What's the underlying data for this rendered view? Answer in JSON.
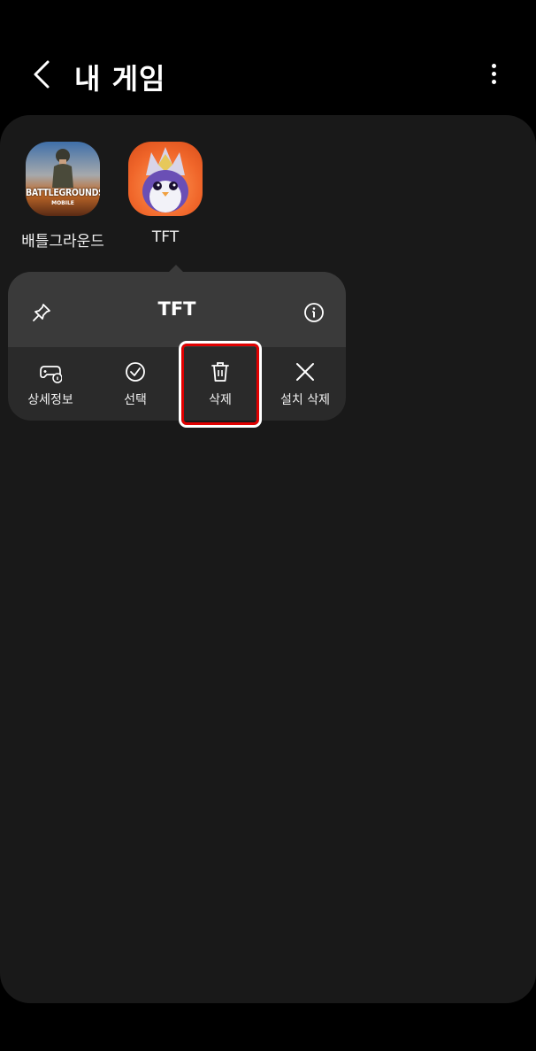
{
  "header": {
    "title": "내 게임",
    "back_icon": "chevron-left-icon",
    "more_icon": "more-vertical-icon"
  },
  "games": [
    {
      "name": "배틀그라운드",
      "icon": "pubg-game-icon",
      "icon_text": "BATTLEGROUNDS",
      "icon_subtext": "MOBILE"
    },
    {
      "name": "TFT",
      "icon": "tft-game-icon"
    }
  ],
  "popup": {
    "title": "TFT",
    "pin_icon": "pin-icon",
    "info_icon": "info-icon",
    "actions": [
      {
        "label": "상세정보",
        "icon": "gamepad-info-icon"
      },
      {
        "label": "선택",
        "icon": "check-circle-icon"
      },
      {
        "label": "삭제",
        "icon": "trash-icon"
      },
      {
        "label": "설치 삭제",
        "icon": "close-icon"
      }
    ]
  },
  "colors": {
    "background": "#000000",
    "panel": "#191919",
    "popup_top": "#3a3a3a",
    "popup_bottom": "#2a2a2a",
    "highlight": "#e00000"
  }
}
